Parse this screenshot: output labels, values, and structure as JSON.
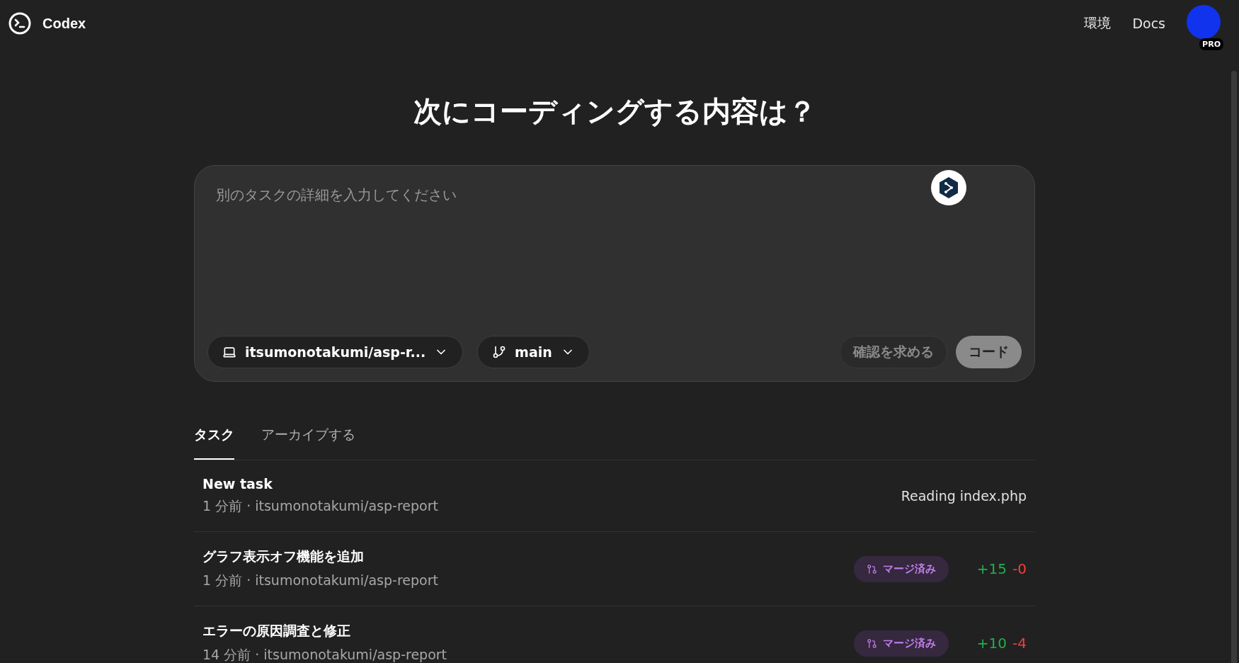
{
  "header": {
    "brand": "Codex",
    "nav": [
      {
        "label": "環境"
      },
      {
        "label": "Docs"
      }
    ],
    "avatar_badge": "PRO"
  },
  "heading": "次にコーディングする内容は？",
  "composer": {
    "placeholder": "別のタスクの詳細を入力してください",
    "repo": "itsumonotakumi/asp-r...",
    "branch": "main",
    "ask_button": "確認を求める",
    "code_button": "コード"
  },
  "tabs": [
    {
      "label": "タスク",
      "selected": true
    },
    {
      "label": "アーカイブする",
      "selected": false
    }
  ],
  "tasks": [
    {
      "kind": "running",
      "title": "New task",
      "meta": "1 分前 · itsumonotakumi/asp-report",
      "status": "Reading index.php"
    },
    {
      "kind": "merged",
      "title": "グラフ表示オフ機能を追加",
      "meta": "1 分前 · itsumonotakumi/asp-report",
      "badge": "マージ済み",
      "added": "+15",
      "removed": "-0"
    },
    {
      "kind": "merged",
      "title": "エラーの原因調査と修正",
      "meta": "14 分前 · itsumonotakumi/asp-report",
      "badge": "マージ済み",
      "added": "+10",
      "removed": "-4"
    }
  ]
}
